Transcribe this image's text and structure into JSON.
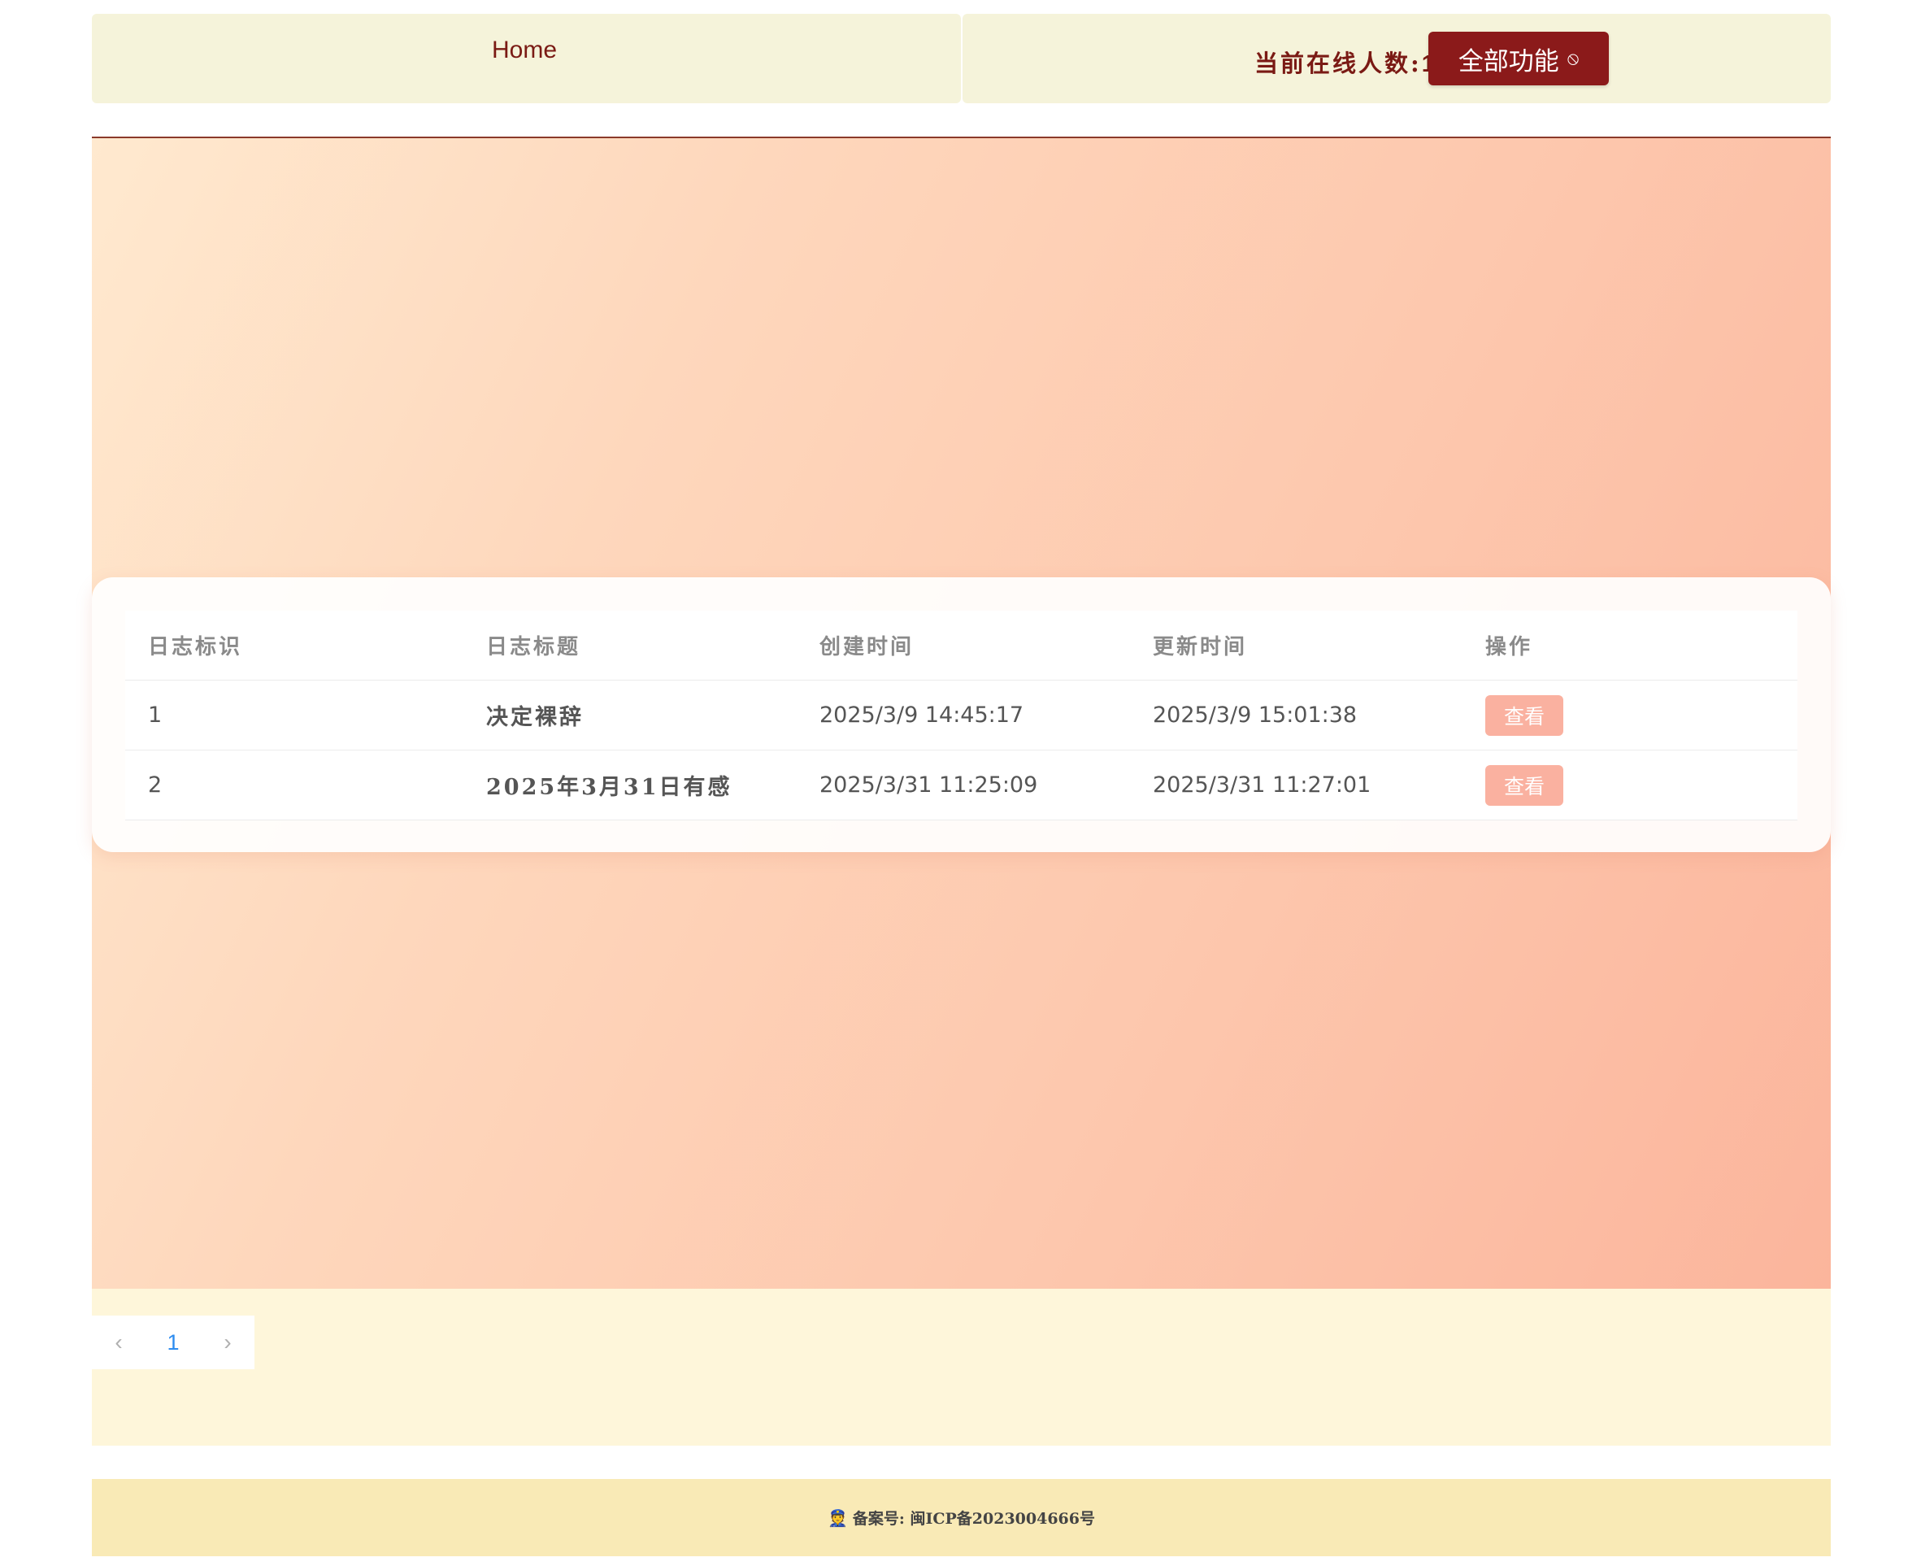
{
  "header": {
    "home_label": "Home",
    "online_label": "当前在线人数:",
    "online_count": "1",
    "sparkle_icon": "✨",
    "all_features_label": "全部功能",
    "all_features_icon": "⦸"
  },
  "table": {
    "headers": [
      "日志标识",
      "日志标题",
      "创建时间",
      "更新时间",
      "操作"
    ],
    "rows": [
      {
        "id": "1",
        "title": "决定裸辞",
        "created": "2025/3/9 14:45:17",
        "updated": "2025/3/9 15:01:38",
        "action": "查看"
      },
      {
        "id": "2",
        "title": "2025年3月31日有感",
        "created": "2025/3/31 11:25:09",
        "updated": "2025/3/31 11:27:01",
        "action": "查看"
      }
    ]
  },
  "pagination": {
    "prev_icon": "‹",
    "current_page": "1",
    "next_icon": "›"
  },
  "footer": {
    "police_icon": "👮",
    "text": "备案号: 闽ICP备2023004666号"
  },
  "colors": {
    "brand": "#8b1a1a",
    "header_bg": "#f5f3da",
    "view_button": "#fab1a0",
    "page_link": "#2d8cf0",
    "footer_bg": "#f9eab6"
  }
}
